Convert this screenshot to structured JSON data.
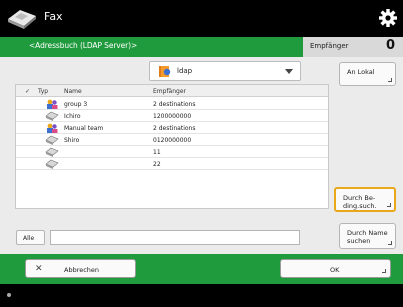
{
  "app": {
    "title": "Fax"
  },
  "breadcrumb": "<Adressbuch (LDAP Server)>",
  "recipients": {
    "label": "Empfänger",
    "count": "0"
  },
  "dropdown": {
    "selected": "ldap"
  },
  "buttons": {
    "an_lokal": "An Lokal",
    "durch_bed": [
      "Durch Be-",
      "ding.such."
    ],
    "durch_name": [
      "Durch Name",
      "suchen"
    ],
    "alle": "Alle",
    "abbrechen": "Abbrechen",
    "ok": "OK"
  },
  "list": {
    "headers": {
      "check": "✓",
      "typ": "Typ",
      "name": "Name",
      "dest": "Empfänger"
    },
    "rows": [
      {
        "type": "group",
        "name": "group 3",
        "dest": "2 destinations"
      },
      {
        "type": "fax",
        "name": "Ichiro",
        "dest": "1200000000"
      },
      {
        "type": "group",
        "name": "Manual team",
        "dest": "2 destinations"
      },
      {
        "type": "fax",
        "name": "Shiro",
        "dest": "0120000000"
      },
      {
        "type": "fax",
        "name": "",
        "dest": "11"
      },
      {
        "type": "fax",
        "name": "",
        "dest": "22"
      }
    ]
  },
  "search": {
    "value": ""
  },
  "colors": {
    "green": "#1f9a3d",
    "highlight": "#e8a81a"
  },
  "icons": [
    "fax-icon",
    "gear-icon",
    "address-book-icon",
    "group-icon",
    "fax-machine-icon",
    "close-icon"
  ]
}
